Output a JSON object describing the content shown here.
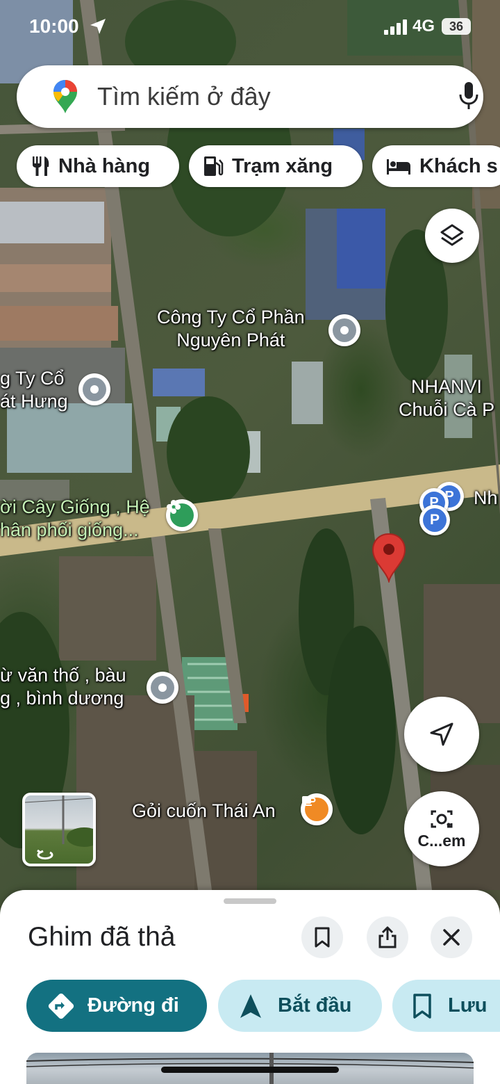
{
  "status_bar": {
    "time": "10:00",
    "network": "4G",
    "battery": "36"
  },
  "search": {
    "placeholder": "Tìm kiếm ở đây",
    "logo_icon": "google-maps-pin-icon",
    "mic_icon": "mic-icon"
  },
  "chips": [
    {
      "label": "Nhà hàng",
      "icon": "restaurant-icon"
    },
    {
      "label": "Trạm xăng",
      "icon": "gas-station-icon"
    },
    {
      "label": "Khách s",
      "icon": "hotel-icon"
    }
  ],
  "map_labels": {
    "nguyen_phat": "Công Ty Cổ Phần\nNguyên Phát",
    "phat_hung": "g Ty Cổ\nát Hưng",
    "nhanvi": "NHANVI\nChuỗi Cà P",
    "cay_giong": "ời Cây Giống , Hệ\nhân phối giống...",
    "van_tho": "ừ văn thố , bàu\ng , bình dương",
    "goi_cuon": "Gỏi cuốn Thái An",
    "parking": "Nh"
  },
  "map_controls": {
    "layers_icon": "layers-icon",
    "location_icon": "navigation-arrow-icon",
    "camera_label": "C...em",
    "camera_icon": "lens-camera-icon"
  },
  "sheet": {
    "title": "Ghim đã thả",
    "actions": {
      "directions": "Đường đi",
      "start": "Bắt đầu",
      "save": "Lưu"
    }
  },
  "colors": {
    "primary_teal": "#137181",
    "chip_teal_light": "#c8eaf2",
    "dropped_pin_red": "#db3a34",
    "poi_gray": "#8a96a0",
    "poi_green": "#2e9d5a",
    "poi_orange": "#f08a24",
    "parking_blue": "#3c74d8"
  }
}
